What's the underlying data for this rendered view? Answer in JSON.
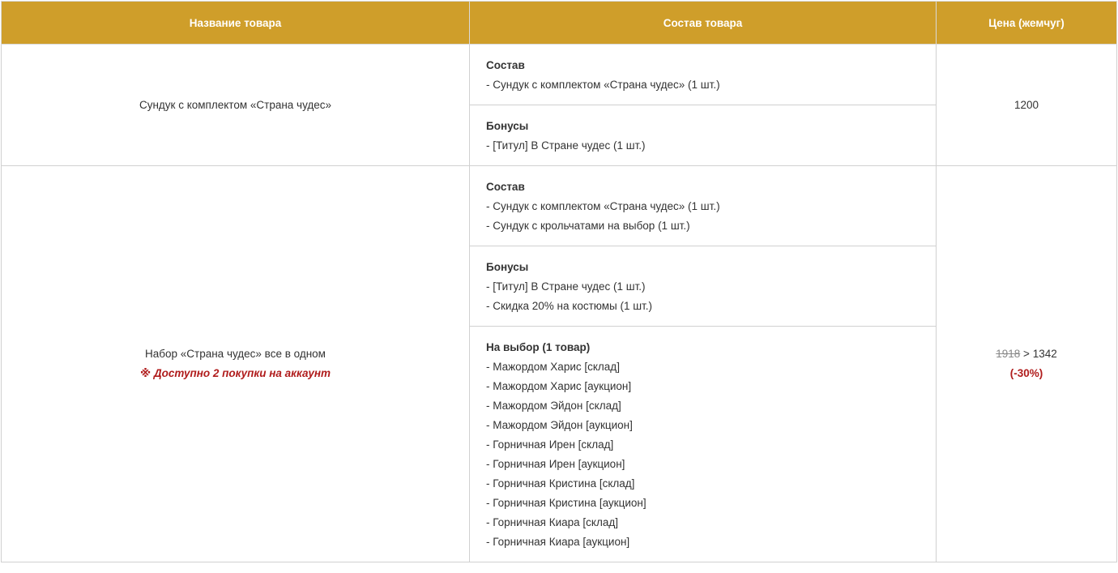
{
  "header": {
    "col_name": "Название товара",
    "col_composition": "Состав товара",
    "col_price": "Цена (жемчуг)"
  },
  "rows": [
    {
      "name": "Сундук с комплектом «Страна чудес»",
      "price": "1200",
      "composition_title": "Состав",
      "composition_items": [
        "- Сундук с комплектом «Страна чудес» (1 шт.)"
      ],
      "bonus_title": "Бонусы",
      "bonus_items": [
        "- [Титул] В Стране чудес (1 шт.)"
      ]
    },
    {
      "name": "Набор «Страна чудес» все в одном",
      "note": "※ Доступно 2 покупки на аккаунт",
      "old_price": "1918",
      "price_separator": " > ",
      "new_price": "1342",
      "discount": "(-30%)",
      "composition_title": "Состав",
      "composition_items": [
        "- Сундук с комплектом «Страна чудес» (1 шт.)",
        "- Сундук с крольчатами на выбор (1 шт.)"
      ],
      "bonus_title": "Бонусы",
      "bonus_items": [
        "- [Титул] В Стране чудес (1 шт.)",
        "- Скидка 20% на костюмы (1 шт.)"
      ],
      "choice_title": "На выбор (1 товар)",
      "choice_items": [
        "- Мажордом Харис [склад]",
        "- Мажордом Харис [аукцион]",
        "- Мажордом Эйдон [склад]",
        "- Мажордом Эйдон [аукцион]",
        "- Горничная Ирен [склад]",
        "- Горничная Ирен [аукцион]",
        "- Горничная Кристина [склад]",
        "- Горничная Кристина [аукцион]",
        "- Горничная Киара [склад]",
        "- Горничная Киара [аукцион]"
      ]
    }
  ],
  "colors": {
    "header_bg": "#cf9e2a",
    "header_text": "#ffffff",
    "accent_red": "#b01c1c",
    "border": "#d0d0d0"
  }
}
